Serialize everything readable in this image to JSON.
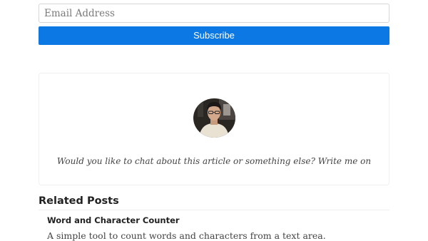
{
  "subscribe": {
    "email_placeholder": "Email Address",
    "button_label": "Subscribe",
    "button_color": "#0b78e3"
  },
  "author_card": {
    "avatar": "author-photo",
    "message": "Would you like to chat about this article or something else? Write me on"
  },
  "related": {
    "heading": "Related Posts",
    "posts": [
      {
        "title": "Word and Character Counter",
        "description": "A simple tool to count words and characters from a text area."
      }
    ]
  }
}
